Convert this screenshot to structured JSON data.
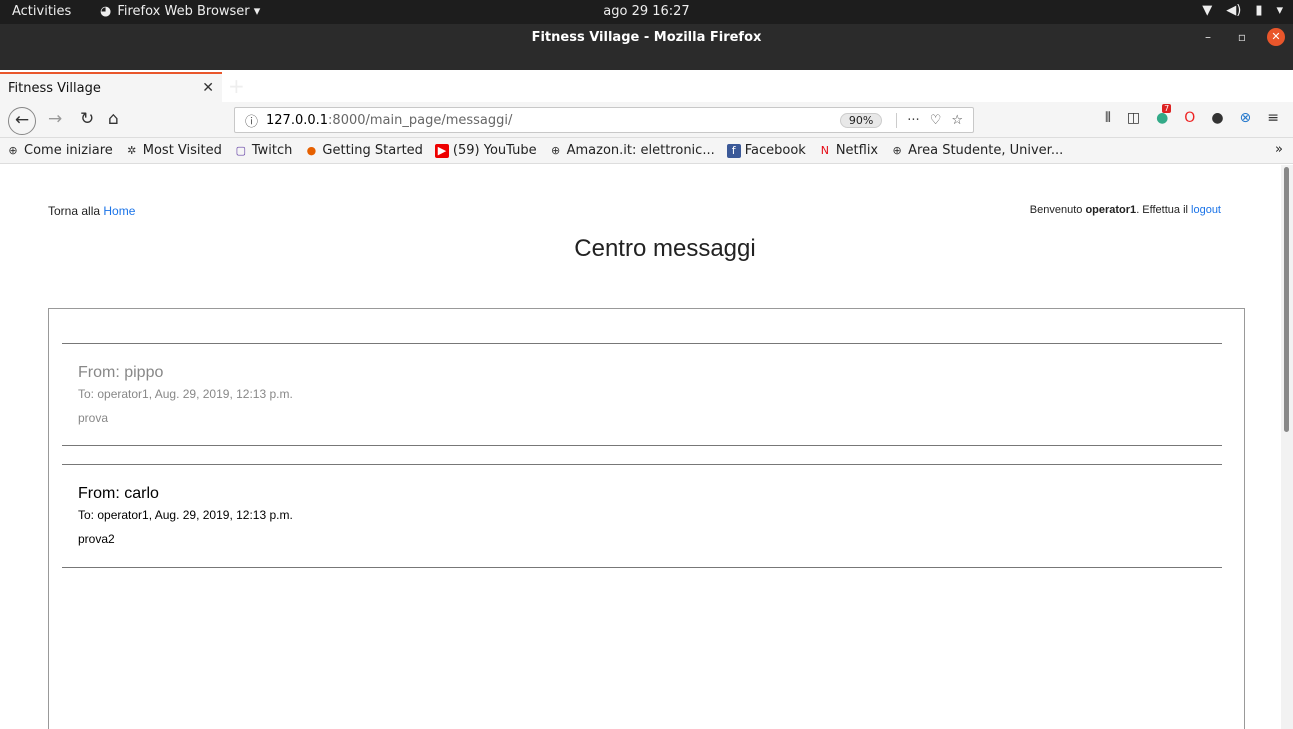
{
  "system": {
    "activities": "Activities",
    "app_name": "Firefox Web Browser ▾",
    "clock": "ago 29  16:27"
  },
  "window": {
    "title": "Fitness Village - Mozilla Firefox"
  },
  "tab": {
    "title": "Fitness Village"
  },
  "url": {
    "host": "127.0.0.1",
    "path": ":8000/main_page/messaggi/",
    "zoom": "90%"
  },
  "bookmarks": [
    {
      "label": "Come iniziare",
      "icon": "globe-icon"
    },
    {
      "label": "Most Visited",
      "icon": "gear-icon"
    },
    {
      "label": "Twitch",
      "icon": "twitch-icon"
    },
    {
      "label": "Getting Started",
      "icon": "firefox-icon"
    },
    {
      "label": "(59) YouTube",
      "icon": "youtube-icon"
    },
    {
      "label": "Amazon.it: elettronic...",
      "icon": "globe-icon"
    },
    {
      "label": "Facebook",
      "icon": "facebook-icon"
    },
    {
      "label": "Netflix",
      "icon": "netflix-icon"
    },
    {
      "label": "Area Studente, Univer...",
      "icon": "globe-icon"
    }
  ],
  "page": {
    "back_prefix": "Torna alla ",
    "back_link": "Home",
    "welcome_prefix": "Benvenuto ",
    "welcome_user": "operator1",
    "welcome_mid": ". Effettua il ",
    "logout_link": "logout",
    "title": "Centro messaggi"
  },
  "messages": [
    {
      "from": "From: pippo",
      "to": "To: operator1, Aug. 29, 2019, 12:13 p.m.",
      "body": "prova",
      "read": true
    },
    {
      "from": "From: carlo",
      "to": "To: operator1, Aug. 29, 2019, 12:13 p.m.",
      "body": "prova2",
      "read": false
    }
  ]
}
